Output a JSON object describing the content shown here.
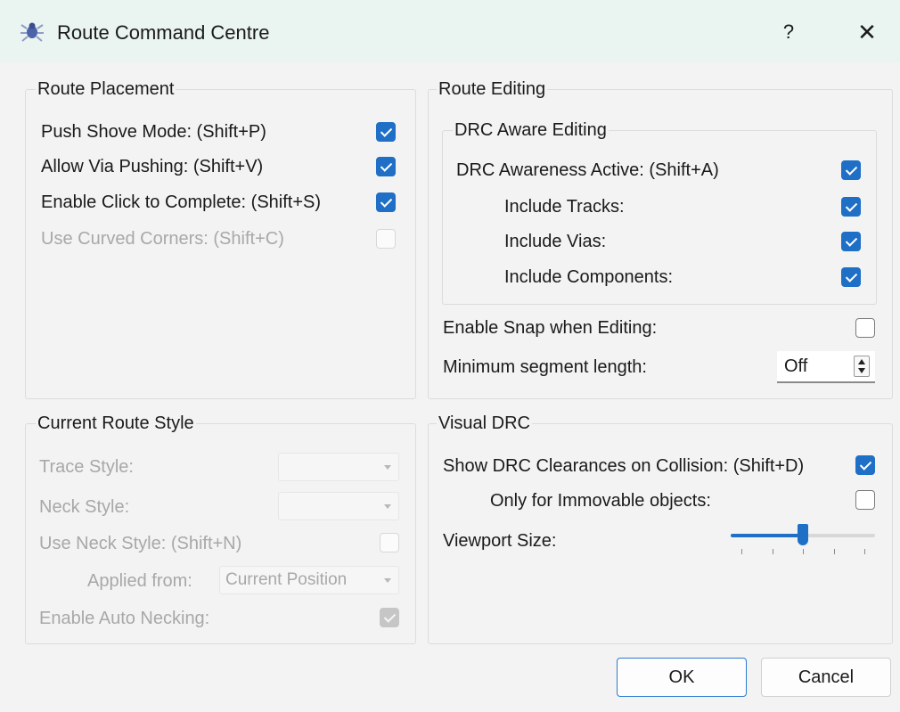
{
  "dialog": {
    "title": "Route Command Centre",
    "help_label": "?",
    "close_label": "✕"
  },
  "route_placement": {
    "title": "Route Placement",
    "push_shove": {
      "label": "Push Shove Mode: (Shift+P)",
      "checked": true
    },
    "via_pushing": {
      "label": "Allow Via Pushing: (Shift+V)",
      "checked": true
    },
    "click_complete": {
      "label": "Enable Click to Complete: (Shift+S)",
      "checked": true
    },
    "curved_corners": {
      "label": "Use Curved Corners: (Shift+C)",
      "checked": false,
      "disabled": true
    }
  },
  "route_editing": {
    "title": "Route Editing",
    "drc_aware": {
      "title": "DRC Aware Editing",
      "active": {
        "label": "DRC Awareness Active: (Shift+A)",
        "checked": true
      },
      "tracks": {
        "label": "Include Tracks:",
        "checked": true
      },
      "vias": {
        "label": "Include Vias:",
        "checked": true
      },
      "components": {
        "label": "Include Components:",
        "checked": true
      }
    },
    "snap": {
      "label": "Enable Snap when Editing:",
      "checked": false
    },
    "min_segment": {
      "label": "Minimum segment length:",
      "value": "Off"
    }
  },
  "route_style": {
    "title": "Current Route Style",
    "trace_style": {
      "label": "Trace Style:",
      "value": ""
    },
    "neck_style": {
      "label": "Neck Style:",
      "value": ""
    },
    "use_neck": {
      "label": "Use Neck Style:  (Shift+N)",
      "checked": false
    },
    "applied_from": {
      "label": "Applied from:",
      "value": "Current Position"
    },
    "auto_necking": {
      "label": "Enable Auto Necking:",
      "checked": true
    }
  },
  "visual_drc": {
    "title": "Visual DRC",
    "show_clearances": {
      "label": "Show DRC Clearances on Collision: (Shift+D)",
      "checked": true
    },
    "immovable": {
      "label": "Only for Immovable objects:",
      "checked": false
    },
    "viewport": {
      "label": "Viewport Size:",
      "value_fraction": 0.5,
      "ticks": 5
    }
  },
  "buttons": {
    "ok": "OK",
    "cancel": "Cancel"
  },
  "colors": {
    "accent": "#1f6fc6",
    "titlebar": "#eaf4f1",
    "background": "#f3f3f3"
  }
}
